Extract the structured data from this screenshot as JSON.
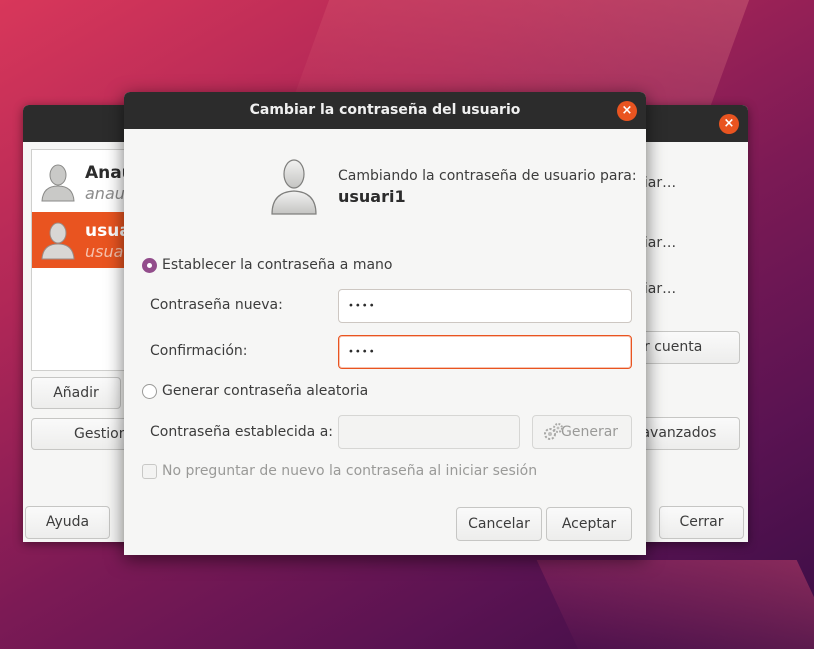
{
  "back_window": {
    "users": [
      {
        "name": "Anaue",
        "login": "anaue",
        "selected": false
      },
      {
        "name": "usuari1",
        "login": "usuari1",
        "selected": true
      }
    ],
    "add_label": "Añadir",
    "manage_label": "Gestionar grupos",
    "change_labels": [
      "Cambiar…",
      "Cambiar…",
      "Cambiar…"
    ],
    "delete_label": "Borrar cuenta",
    "advanced_label": "Ajustes avanzados",
    "help_label": "Ayuda",
    "close_label": "Cerrar",
    "close_icon": "×"
  },
  "dialog": {
    "title": "Cambiar la contraseña del usuario",
    "close_icon": "×",
    "header_text": "Cambiando la contraseña de usuario para:",
    "username": "usuari1",
    "manual_option_label": "Establecer la contraseña a mano",
    "manual_selected": true,
    "new_password_label": "Contraseña nueva:",
    "new_password_value": "••••",
    "confirm_label": "Confirmación:",
    "confirm_value": "••••",
    "random_option_label": "Generar contraseña aleatoria",
    "set_password_label": "Contraseña establecida a:",
    "generate_label": "Generar",
    "no_ask_label": "No preguntar de nuevo la contraseña al iniciar sesión",
    "cancel_label": "Cancelar",
    "accept_label": "Aceptar"
  },
  "colors": {
    "accent": "#e95420",
    "radio_selected": "#924d8b",
    "titlebar": "#2c2c2c"
  },
  "icons": {
    "avatar": "user-avatar-icon",
    "generate": "gear-icon"
  }
}
